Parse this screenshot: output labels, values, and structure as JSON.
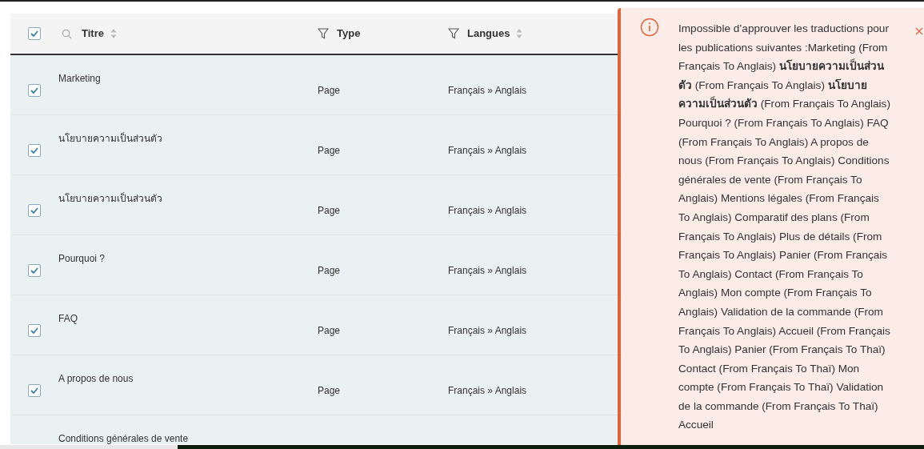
{
  "table": {
    "select_all": {
      "checked": true
    },
    "columns": [
      {
        "label": "Titre",
        "kind": "search",
        "sortable": true
      },
      {
        "label": "Type",
        "kind": "filter",
        "sortable": false
      },
      {
        "label": "Langues",
        "kind": "filter",
        "sortable": true
      }
    ],
    "rows": [
      {
        "checked": true,
        "title": "Marketing",
        "type": "Page",
        "languages": "Français » Anglais"
      },
      {
        "checked": true,
        "title": "นโยบายความเป็นส่วนตัว",
        "type": "Page",
        "languages": "Français » Anglais"
      },
      {
        "checked": true,
        "title": "นโยบายความเป็นส่วนตัว",
        "type": "Page",
        "languages": "Français » Anglais"
      },
      {
        "checked": true,
        "title": "Pourquoi ?",
        "type": "Page",
        "languages": "Français » Anglais"
      },
      {
        "checked": true,
        "title": "FAQ",
        "type": "Page",
        "languages": "Français » Anglais"
      },
      {
        "checked": true,
        "title": "A propos de nous",
        "type": "Page",
        "languages": "Français » Anglais"
      },
      {
        "title": "Conditions générales de vente"
      }
    ]
  },
  "notification": {
    "kind": "error",
    "message": "Impossible d’approuver les traductions pour les publications suivantes :Marketing (From Français To Anglais) **นโยบายความเป็นส่วนตัว** (From Français To Anglais) **นโยบายความเป็นส่วนตัว** (From Français To Anglais) Pourquoi ? (From Français To Anglais) FAQ (From Français To Anglais) A propos de nous (From Français To Anglais) Conditions générales de vente (From Français To Anglais) Mentions légales (From Français To Anglais) Comparatif des plans (From Français To Anglais) Plus de détails (From Français To Anglais) Panier (From Français To Anglais) Contact (From Français To Anglais) Mon compte (From Français To Anglais) Validation de la commande (From Français To Anglais) Accueil (From Français To Anglais) Panier (From Français To Thaï) Contact (From Français To Thaï) Mon compte (From Français To Thaï) Validation de la commande (From Français To Thaï) Accueil"
  }
}
